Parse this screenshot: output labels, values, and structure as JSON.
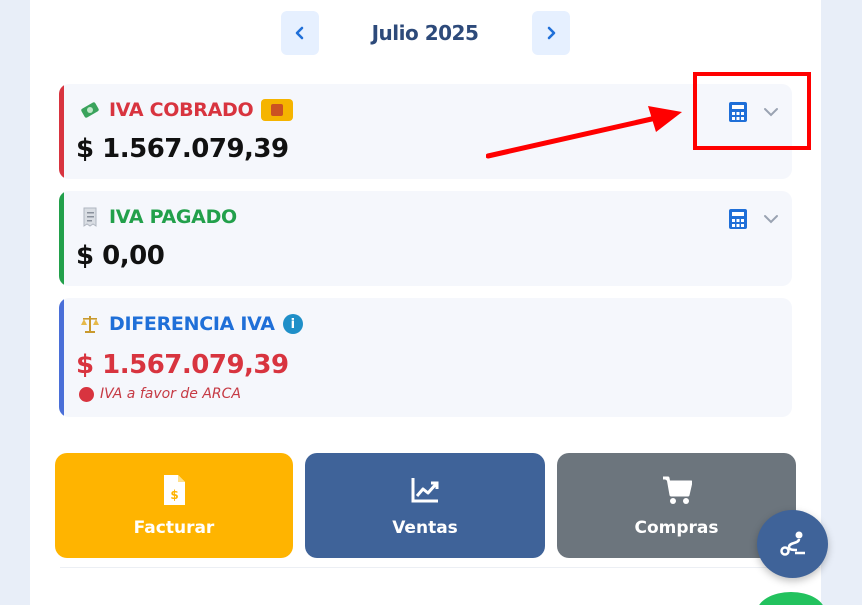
{
  "month_nav": {
    "title": "Julio 2025",
    "prev_icon": "chevron-left-icon",
    "next_icon": "chevron-right-icon"
  },
  "cards": {
    "cobrado": {
      "icon": "money-icon",
      "label": "IVA COBRADO",
      "badge_icon": "ledger-icon",
      "amount": "$ 1.567.079,39",
      "color": "#d8343f"
    },
    "pagado": {
      "icon": "receipt-icon",
      "label": "IVA PAGADO",
      "amount": "$ 0,00",
      "color": "#22a04b"
    },
    "diferencia": {
      "icon": "balance-scale-icon",
      "label": "DIFERENCIA IVA",
      "info_icon": "info-icon",
      "amount": "$ 1.567.079,39",
      "note": "IVA a favor de ARCA",
      "color": "#1f6fd8"
    }
  },
  "actions": {
    "facturar": {
      "label": "Facturar",
      "icon": "invoice-icon",
      "color": "#ffb400"
    },
    "ventas": {
      "label": "Ventas",
      "icon": "chart-line-icon",
      "color": "#3f6399"
    },
    "compras": {
      "label": "Compras",
      "icon": "cart-icon",
      "color": "#6c757d"
    }
  },
  "fab": {
    "icon": "route-icon"
  }
}
